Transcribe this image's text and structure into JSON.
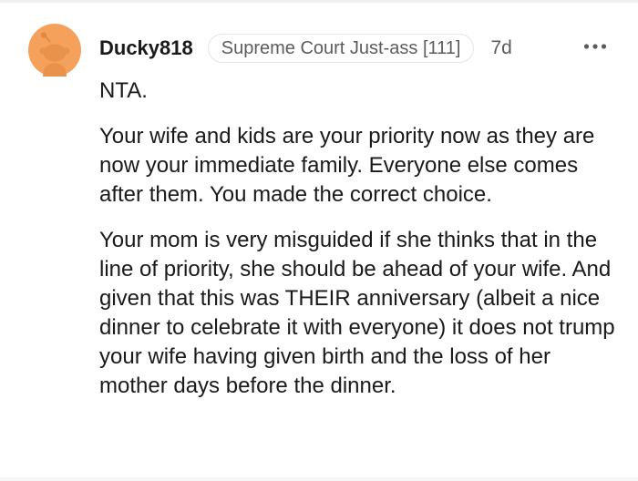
{
  "comment": {
    "author": "Ducky818",
    "flair": "Supreme Court Just-ass [111]",
    "age": "7d",
    "paragraphs": [
      "NTA.",
      "Your wife and kids are your priority now as they are now your immediate family. Everyone else comes after them. You made the correct choice.",
      "Your mom is very misguided if she thinks that in the line of priority, she should be ahead of your wife. And given that this was THEIR anniversary (albeit a nice dinner to celebrate it with everyone) it does not trump your wife having given birth and the loss of her mother days before the dinner."
    ],
    "avatar_icon": "snoo-avatar-icon",
    "more_icon": "more-options-icon",
    "colors": {
      "avatar_bg": "#f5a15b",
      "avatar_figure": "#ffffff",
      "text": "#1a1a1b",
      "muted": "#5c5c5c"
    }
  }
}
